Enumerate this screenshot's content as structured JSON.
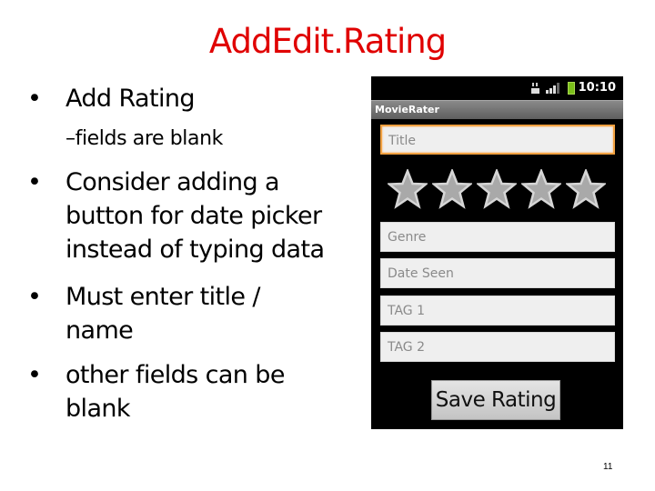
{
  "slide": {
    "title": "AddEdit.Rating",
    "page_number": "11",
    "title_color": "#e00000"
  },
  "bullets": [
    {
      "level": 1,
      "lines": [
        "Add Rating"
      ]
    },
    {
      "level": 2,
      "lines": [
        "fields are blank"
      ]
    },
    {
      "level": 1,
      "lines": [
        "Consider adding a",
        "button for date picker",
        "instead of typing data"
      ]
    },
    {
      "level": 1,
      "lines": [
        "Must enter title /",
        "name"
      ]
    },
    {
      "level": 1,
      "lines": [
        "other fields can be",
        "blank"
      ]
    }
  ],
  "bullet_glyphs": {
    "level1": "•",
    "level2": "–"
  },
  "phone": {
    "status_bar": {
      "time": "10:10",
      "icons": [
        "network-3g-icon",
        "signal-strength-icon",
        "battery-charging-icon"
      ]
    },
    "app_title": "MovieRater",
    "fields": [
      {
        "name": "title",
        "placeholder": "Title",
        "value": "",
        "focused": true
      },
      {
        "name": "genre",
        "placeholder": "Genre",
        "value": ""
      },
      {
        "name": "date-seen",
        "placeholder": "Date Seen",
        "value": ""
      },
      {
        "name": "tag1",
        "placeholder": "TAG 1",
        "value": ""
      },
      {
        "name": "tag2",
        "placeholder": "TAG 2",
        "value": ""
      }
    ],
    "rating": {
      "max_stars": 5,
      "selected": 0
    },
    "save_button_label": "Save Rating"
  }
}
